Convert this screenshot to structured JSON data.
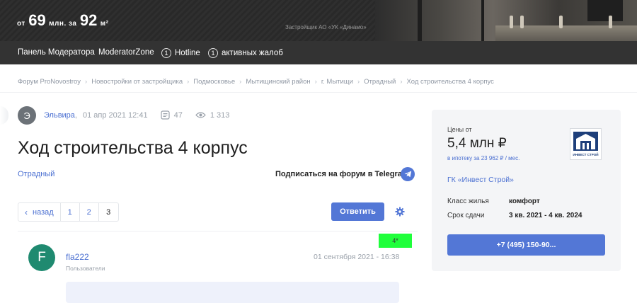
{
  "banner": {
    "from_label": "от",
    "price_value": "69",
    "price_unit": "млн. за",
    "area_value": "92",
    "area_unit": "м²",
    "developer_text": "Застройщик АО «УК «Динамо»"
  },
  "modbar": {
    "panel_label": "Панель Модератора",
    "zone_label": "ModeratorZone",
    "hotline_count": "1",
    "hotline_label": "Hotline",
    "complaints_count": "1",
    "complaints_label": "активных жалоб"
  },
  "breadcrumbs": {
    "items": [
      "Форум ProNovostroy",
      "Новостройки от застройщика",
      "Подмосковье",
      "Мытищинский район",
      "г. Мытищи",
      "Отрадный",
      "Ход строительства 4 корпус"
    ],
    "separator": "›"
  },
  "topic": {
    "author_initial": "Э",
    "author_name": "Эльвира",
    "comma": ",",
    "date": "01 апр 2021 12:41",
    "posts_count": "47",
    "views_count": "1 313",
    "title": "Ход строительства 4 корпус",
    "tag": "Отрадный",
    "telegram_text": "Подписаться на форум в Telegram"
  },
  "pager": {
    "back_label": "назад",
    "pages": [
      "1",
      "2",
      "3"
    ],
    "active_page": "3"
  },
  "reply_label": "Ответить",
  "badge_text": "4*",
  "post": {
    "avatar_initial": "F",
    "username": "fla222",
    "role": "Пользователи",
    "date": "01 сентября 2021 - 16:38"
  },
  "card": {
    "price_label": "Цены от",
    "price": "5,4 млн ₽",
    "mortgage": "в ипотеку за 23 962 ₽ / мес.",
    "logo_text": "ИНВЕСТ СТРОЙ",
    "developer": "ГК «Инвест Строй»",
    "rows": [
      {
        "label": "Класс жилья",
        "value": "комфорт"
      },
      {
        "label": "Срок сдачи",
        "value": "3 кв. 2021 - 4 кв. 2024"
      }
    ],
    "phone": "+7 (495) 150-90..."
  },
  "colors": {
    "accent": "#5377d6",
    "link": "#4a6fd1",
    "badge": "#1fff3b",
    "modbar": "#333333"
  }
}
